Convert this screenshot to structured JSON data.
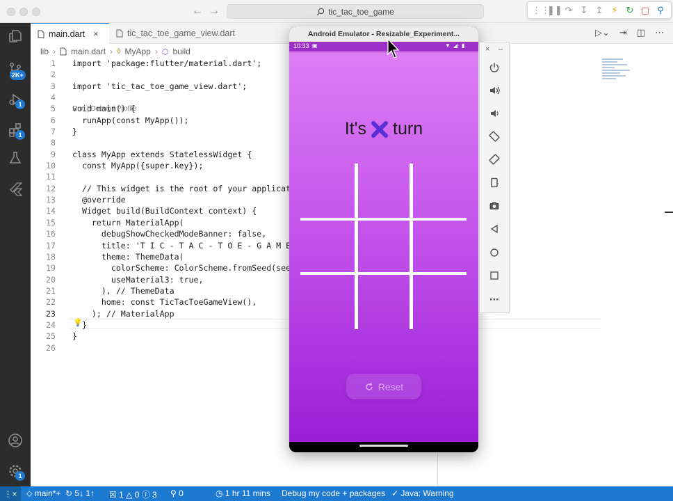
{
  "window": {
    "search_text": "tic_tac_toe_game"
  },
  "activity_bar": {
    "source_control_badge": "2K+",
    "run_debug_badge": "1",
    "extensions_badge": "1",
    "settings_badge": "1"
  },
  "tabs": [
    {
      "label": "main.dart",
      "active": true
    },
    {
      "label": "tic_tac_toe_game_view.dart",
      "active": false
    }
  ],
  "breadcrumb": [
    "lib",
    "main.dart",
    "MyApp",
    "build"
  ],
  "codelens": "Run | Debug | Profile",
  "code": [
    {
      "n": "1",
      "t": "import 'package:flutter/material.dart';"
    },
    {
      "n": "2",
      "t": ""
    },
    {
      "n": "3",
      "t": "import 'tic_tac_toe_game_view.dart';"
    },
    {
      "n": "4",
      "t": ""
    },
    {
      "n": "5",
      "t": "void main() {"
    },
    {
      "n": "6",
      "t": "  runApp(const MyApp());"
    },
    {
      "n": "7",
      "t": "}"
    },
    {
      "n": "8",
      "t": ""
    },
    {
      "n": "9",
      "t": "class MyApp extends StatelessWidget {"
    },
    {
      "n": "10",
      "t": "  const MyApp({super.key});"
    },
    {
      "n": "11",
      "t": ""
    },
    {
      "n": "12",
      "t": "  // This widget is the root of your application"
    },
    {
      "n": "13",
      "t": "  @override"
    },
    {
      "n": "14",
      "t": "  Widget build(BuildContext context) {"
    },
    {
      "n": "15",
      "t": "    return MaterialApp("
    },
    {
      "n": "16",
      "t": "      debugShowCheckedModeBanner: false,"
    },
    {
      "n": "17",
      "t": "      title: 'T I C - T A C - T O E - G A M E',"
    },
    {
      "n": "18",
      "t": "      theme: ThemeData("
    },
    {
      "n": "19",
      "t": "        colorScheme: ColorScheme.fromSeed(seedCo"
    },
    {
      "n": "20",
      "t": "        useMaterial3: true,"
    },
    {
      "n": "21",
      "t": "      ), // ThemeData"
    },
    {
      "n": "22",
      "t": "      home: const TicTacToeGameView(),"
    },
    {
      "n": "23",
      "t": "    ); // MaterialApp"
    },
    {
      "n": "24",
      "t": "  }"
    },
    {
      "n": "25",
      "t": "}"
    },
    {
      "n": "26",
      "t": ""
    }
  ],
  "emulator": {
    "title": "Android Emulator - Resizable_Experiment...",
    "time": "10:33",
    "turn_prefix": "It's",
    "turn_suffix": "turn",
    "current_player": "X",
    "reset_label": "Reset",
    "board": [
      "",
      "",
      "",
      "",
      "",
      "",
      "",
      "",
      ""
    ]
  },
  "statusbar": {
    "branch": "main*+",
    "sync": "5↓ 1↑",
    "errors": "1",
    "warnings": "0",
    "infos": "3",
    "ports": "0",
    "time_tracker": "1 hr 11 mins",
    "debug_mode": "Debug my code + packages",
    "java": "Java: Warning"
  },
  "colors": {
    "accent": "#1e79d1",
    "phone_top": "#e07ff5",
    "phone_bottom": "#9b1ed6",
    "player_x": "#5b2fd6"
  }
}
